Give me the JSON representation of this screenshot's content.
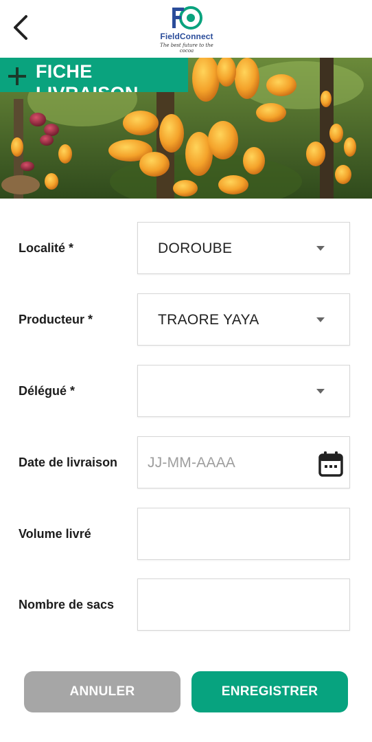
{
  "app": {
    "name_part1": "Field",
    "name_part2": "Connect",
    "tagline": "The best future to the cocoa",
    "logo_letters": "FC"
  },
  "header": {
    "title": "FICHE LIVRAISON"
  },
  "form": {
    "localite": {
      "label": "Localité *",
      "value": "DOROUBE"
    },
    "producteur": {
      "label": "Producteur *",
      "value": "TRAORE YAYA"
    },
    "delegue": {
      "label": "Délégué *",
      "value": ""
    },
    "date": {
      "label": "Date de livraison",
      "placeholder": "JJ-MM-AAAA"
    },
    "volume": {
      "label": "Volume livré",
      "value": ""
    },
    "sacs": {
      "label": "Nombre de sacs",
      "value": ""
    }
  },
  "actions": {
    "cancel_label": "ANNULER",
    "save_label": "ENREGISTRER"
  },
  "colors": {
    "primary": "#07a37f",
    "cancel": "#a6a6a6",
    "brand_blue": "#2a4c9a"
  }
}
